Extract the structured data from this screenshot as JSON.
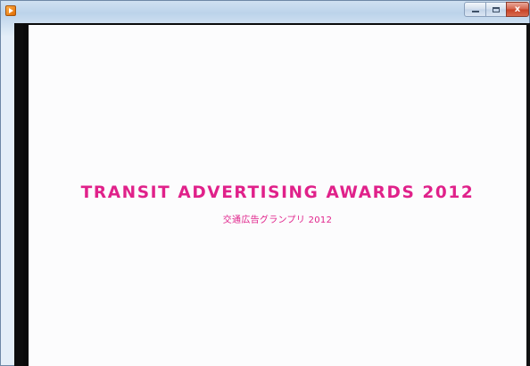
{
  "window": {
    "title": "",
    "controls": {
      "minimize": "minimize",
      "maximize": "maximize",
      "close": "x"
    }
  },
  "slide": {
    "headline": "TRANSIT ADVERTISING AWARDS 2012",
    "subline": "交通広告グランプリ 2012",
    "accent_color": "#e0218a",
    "background_color": "#fcfcfd"
  }
}
